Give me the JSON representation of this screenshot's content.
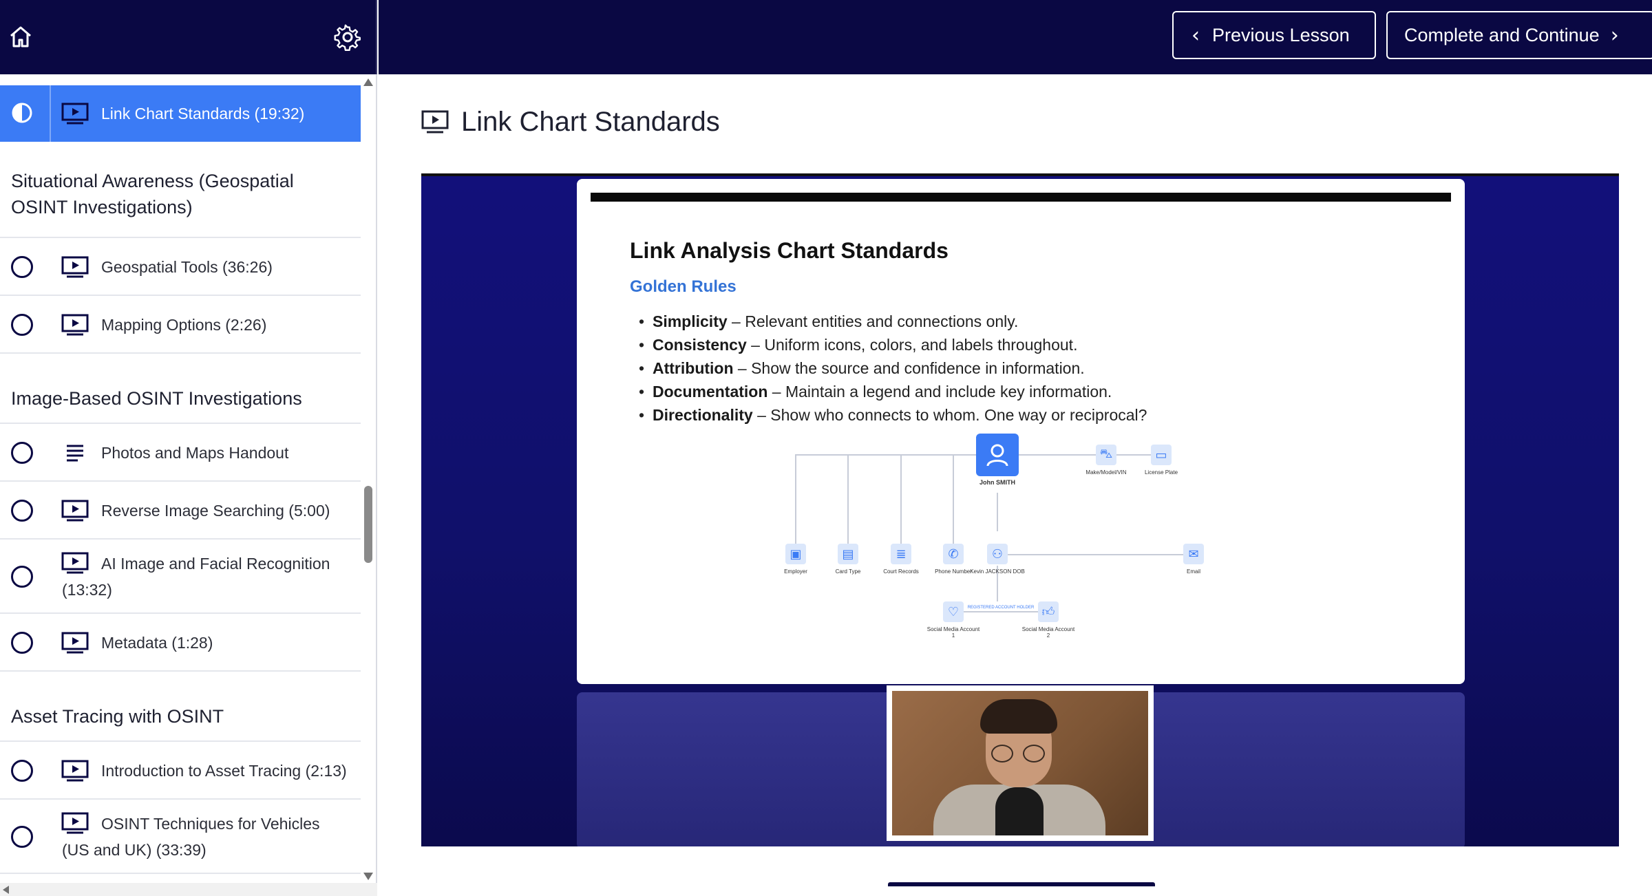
{
  "sidebar": {
    "active_lesson": {
      "label": "Link Chart Standards (19:32)"
    },
    "sections": [
      {
        "title": "Situational Awareness (Geospatial OSINT Investigations)",
        "lessons": [
          {
            "label": "Geospatial Tools (36:26)",
            "type": "video"
          },
          {
            "label": "Mapping Options (2:26)",
            "type": "video"
          }
        ]
      },
      {
        "title": "Image-Based OSINT Investigations",
        "lessons": [
          {
            "label": "Photos and Maps Handout",
            "type": "text"
          },
          {
            "label": "Reverse Image Searching (5:00)",
            "type": "video"
          },
          {
            "label": "AI Image and Facial Recognition (13:32)",
            "type": "video"
          },
          {
            "label": "Metadata (1:28)",
            "type": "video"
          }
        ]
      },
      {
        "title": "Asset Tracing with OSINT",
        "lessons": [
          {
            "label": "Introduction to Asset Tracing (2:13)",
            "type": "video"
          },
          {
            "label": "OSINT Techniques for Vehicles (US and UK) (33:39)",
            "type": "video"
          }
        ]
      }
    ]
  },
  "topbar": {
    "prev_label": "Previous Lesson",
    "next_label": "Complete and Continue"
  },
  "main": {
    "title": "Link Chart Standards",
    "slide": {
      "title": "Link Analysis Chart Standards",
      "subtitle": "Golden Rules",
      "rules": [
        {
          "term": "Simplicity",
          "text": " – Relevant entities and connections only."
        },
        {
          "term": "Consistency",
          "text": " – Uniform icons, colors, and labels throughout."
        },
        {
          "term": "Attribution",
          "text": " – Show the source and confidence in information."
        },
        {
          "term": "Documentation",
          "text": " – Maintain a legend and include key information."
        },
        {
          "term": "Directionality",
          "text": " – Show who connects to whom. One way or reciprocal?"
        }
      ],
      "diagram": {
        "hub": "John SMITH",
        "top_right": [
          "Make/Model/VIN",
          "License Plate"
        ],
        "row": [
          "Employer",
          "Card Type",
          "Court Records",
          "Phone Number",
          "Kevin JACKSON DOB",
          "Email"
        ],
        "bottom": [
          "Social Media Account 1",
          "Social Media Account 2"
        ],
        "link_label": "REGISTERED ACCOUNT HOLDER"
      }
    }
  },
  "colors": {
    "nav": "#0a0843",
    "active": "#3b7bf5",
    "accent": "#3473d6"
  }
}
